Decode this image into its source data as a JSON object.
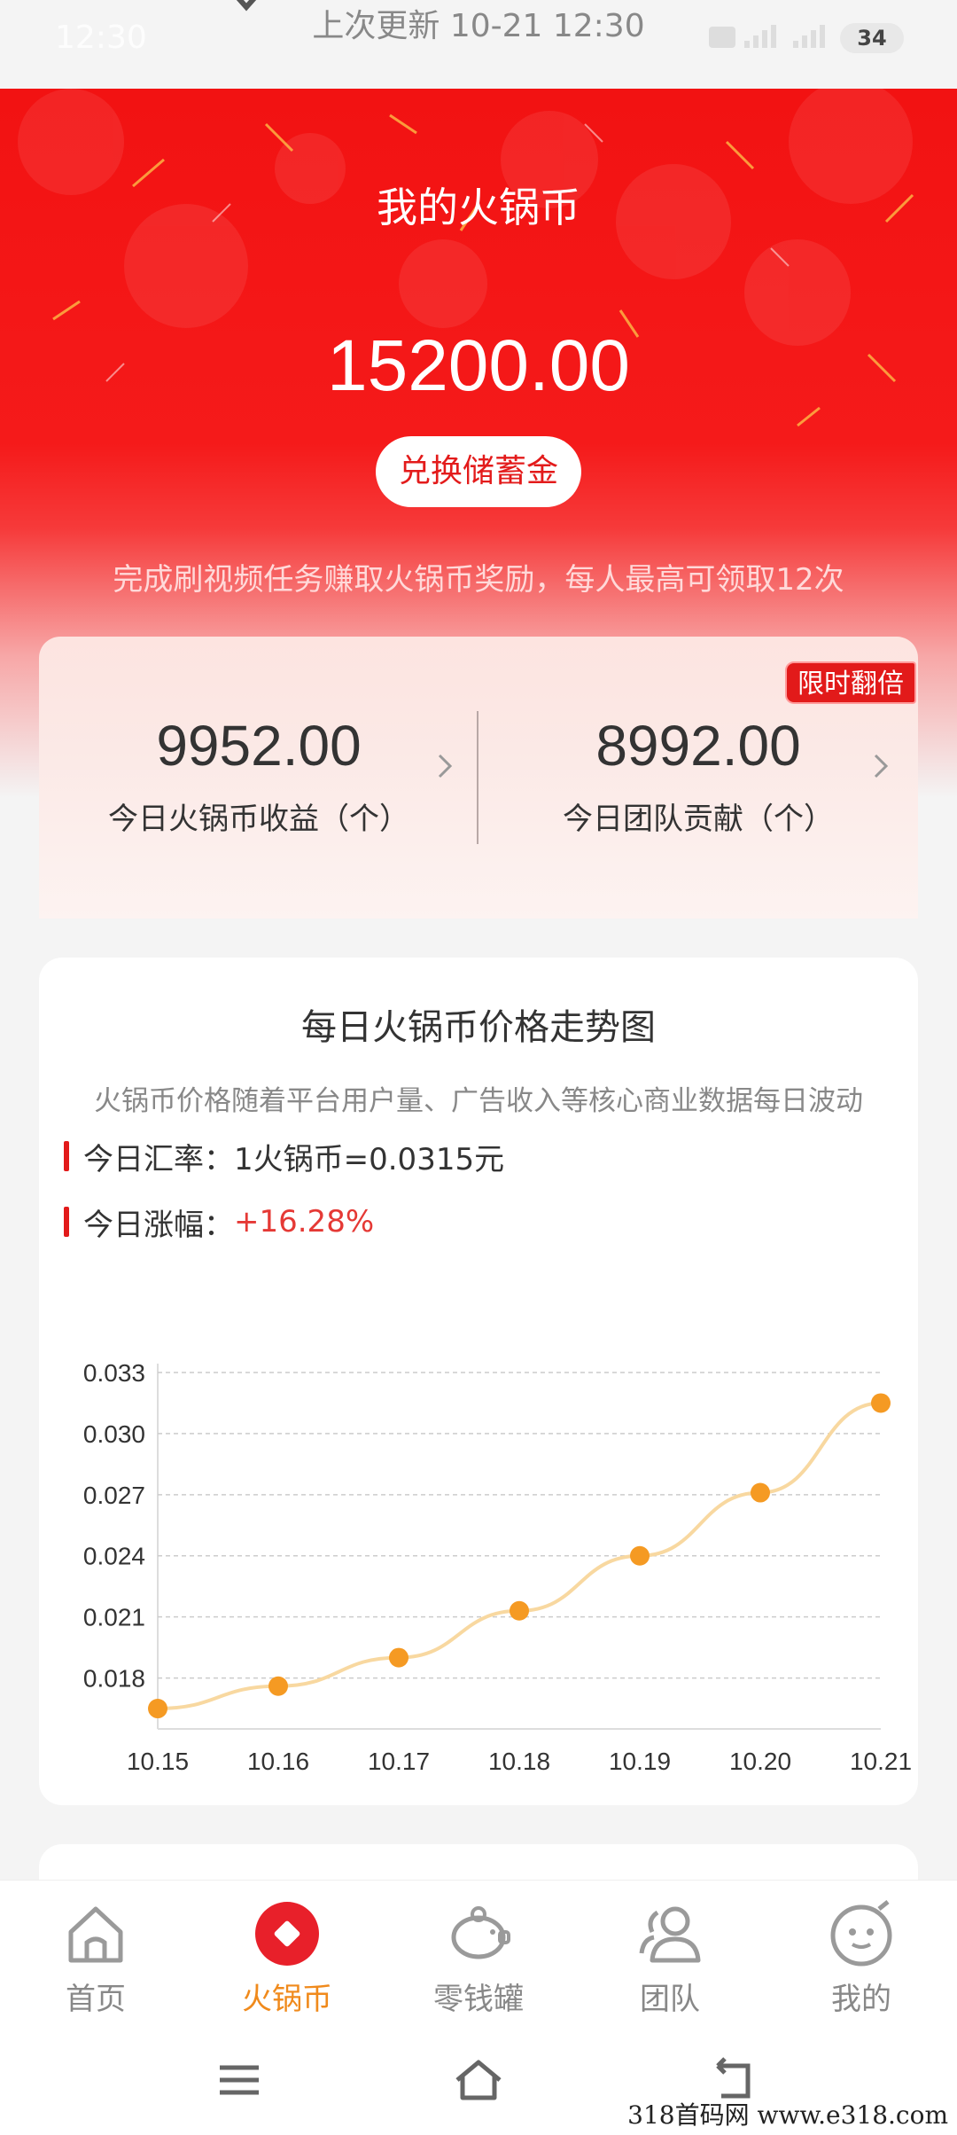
{
  "status_bar": {
    "time": "12:30",
    "last_update": "上次更新 10-21 12:30",
    "battery": "34"
  },
  "hero": {
    "title": "我的火锅币",
    "balance": "15200.00",
    "exchange_button": "兑换储蓄金",
    "note": "完成刷视频任务赚取火锅币奖励，每人最高可领取12次"
  },
  "stats": {
    "badge": "限时翻倍",
    "today_earnings_value": "9952.00",
    "today_earnings_label": "今日火锅币收益（个）",
    "team_contribution_value": "8992.00",
    "team_contribution_label": "今日团队贡献（个）"
  },
  "trend": {
    "title": "每日火锅币价格走势图",
    "subtitle": "火锅币价格随着平台用户量、广告收入等核心商业数据每日波动",
    "rate_label": "今日汇率：",
    "rate_value": "1火锅币=0.0315元",
    "rise_label": "今日涨幅：",
    "rise_value": "+16.28%"
  },
  "chart_data": {
    "type": "line",
    "x": [
      "10.15",
      "10.16",
      "10.17",
      "10.18",
      "10.19",
      "10.20",
      "10.21"
    ],
    "values": [
      0.0165,
      0.0176,
      0.019,
      0.0213,
      0.024,
      0.0271,
      0.0315
    ],
    "y_ticks": [
      "0.018",
      "0.021",
      "0.024",
      "0.027",
      "0.030",
      "0.033"
    ],
    "ylim": [
      0.0155,
      0.033
    ],
    "grid": true,
    "line_color": "#f8d8a0",
    "point_color": "#f59a23"
  },
  "bottom_nav": {
    "items": [
      {
        "label": "首页",
        "icon": "home-icon"
      },
      {
        "label": "火锅币",
        "icon": "coin-icon"
      },
      {
        "label": "零钱罐",
        "icon": "piggy-bank-icon"
      },
      {
        "label": "团队",
        "icon": "team-icon"
      },
      {
        "label": "我的",
        "icon": "profile-icon"
      }
    ],
    "active_color": "#f08a1c",
    "inactive_color": "#888888"
  },
  "watermark": "318首码网  www.e318.com"
}
